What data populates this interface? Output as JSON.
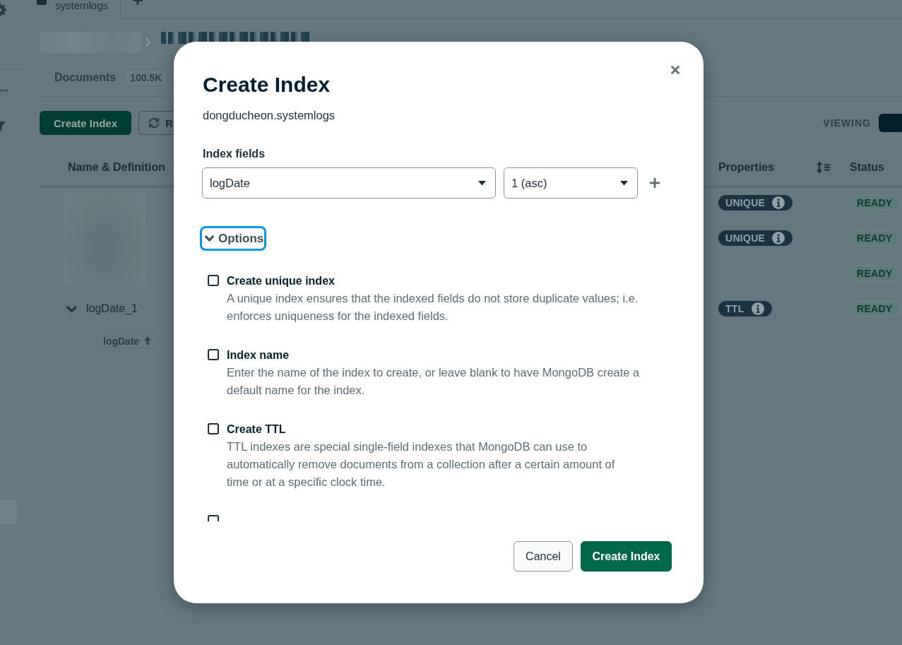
{
  "tabs": [
    {
      "label": "systemlogs",
      "selected": true
    }
  ],
  "collection": {
    "documents_label": "Documents",
    "documents_count": "100.5K"
  },
  "toolbar": {
    "buttons": [
      {
        "kind": "primary",
        "label": "Create Index"
      },
      {
        "kind": "refresh",
        "label": "R"
      }
    ],
    "viewing_label": "VIEWING"
  },
  "table": {
    "columns": [
      {
        "kind": "text",
        "label": "Name & Definition"
      },
      {
        "kind": "text",
        "label": "Properties"
      },
      {
        "kind": "sort_icon"
      },
      {
        "kind": "text",
        "label": "Status"
      }
    ],
    "rows": [
      {
        "properties": [
          {
            "label": "UNIQUE"
          }
        ],
        "status": "READY"
      },
      {
        "properties": [
          {
            "label": "UNIQUE"
          }
        ],
        "status": "READY"
      },
      {
        "status": "READY"
      },
      {
        "name": "logDate_1",
        "expanded": true,
        "keys": [
          {
            "field": "logDate"
          }
        ],
        "properties": [
          {
            "label": "TTL"
          }
        ],
        "status": "READY"
      }
    ]
  },
  "modal": {
    "title": "Create Index",
    "namespace": "dongducheon.systemlogs",
    "index_fields": {
      "label": "Index fields",
      "rows": [
        {
          "field": "logDate",
          "type": "1 (asc)"
        }
      ]
    },
    "options_toggle": {
      "label": "Options",
      "expanded": true,
      "focused": true
    },
    "options": [
      {
        "label": "Create unique index",
        "description": "A unique index ensures that the indexed fields do not store duplicate values; i.e. enforces uniqueness for the indexed fields.",
        "checked": false
      },
      {
        "label": "Index name",
        "description": "Enter the name of the index to create, or leave blank to have MongoDB create a default name for the index.",
        "checked": false
      },
      {
        "label": "Create TTL",
        "description": "TTL indexes are special single-field indexes that MongoDB can use to automatically remove documents from a collection after a certain amount of time or at a specific clock time.",
        "checked": false
      },
      {
        "checked": false
      }
    ],
    "buttons": [
      {
        "kind": "secondary",
        "label": "Cancel"
      },
      {
        "kind": "primary",
        "label": "Create Index"
      }
    ]
  }
}
